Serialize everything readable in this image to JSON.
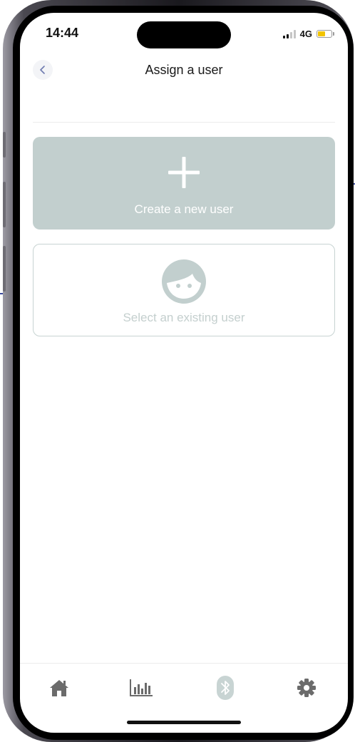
{
  "status_bar": {
    "time": "14:44",
    "network": "4G",
    "battery_level": 0.55
  },
  "header": {
    "title": "Assign a user",
    "back_icon": "chevron-left-icon"
  },
  "options": {
    "create": {
      "label": "Create a new user",
      "icon": "plus-icon"
    },
    "select": {
      "label": "Select an existing user",
      "icon": "user-face-icon"
    }
  },
  "bottom_nav": {
    "items": [
      {
        "icon": "home-icon"
      },
      {
        "icon": "bar-chart-icon"
      },
      {
        "icon": "bluetooth-icon"
      },
      {
        "icon": "gear-icon"
      }
    ]
  },
  "colors": {
    "card_accent": "#c2cfce",
    "icon_muted": "#6b6b6b",
    "bluetooth_muted": "#c8d4d3",
    "callout_line": "#3a4a9e",
    "battery_fill": "#f2c400"
  }
}
